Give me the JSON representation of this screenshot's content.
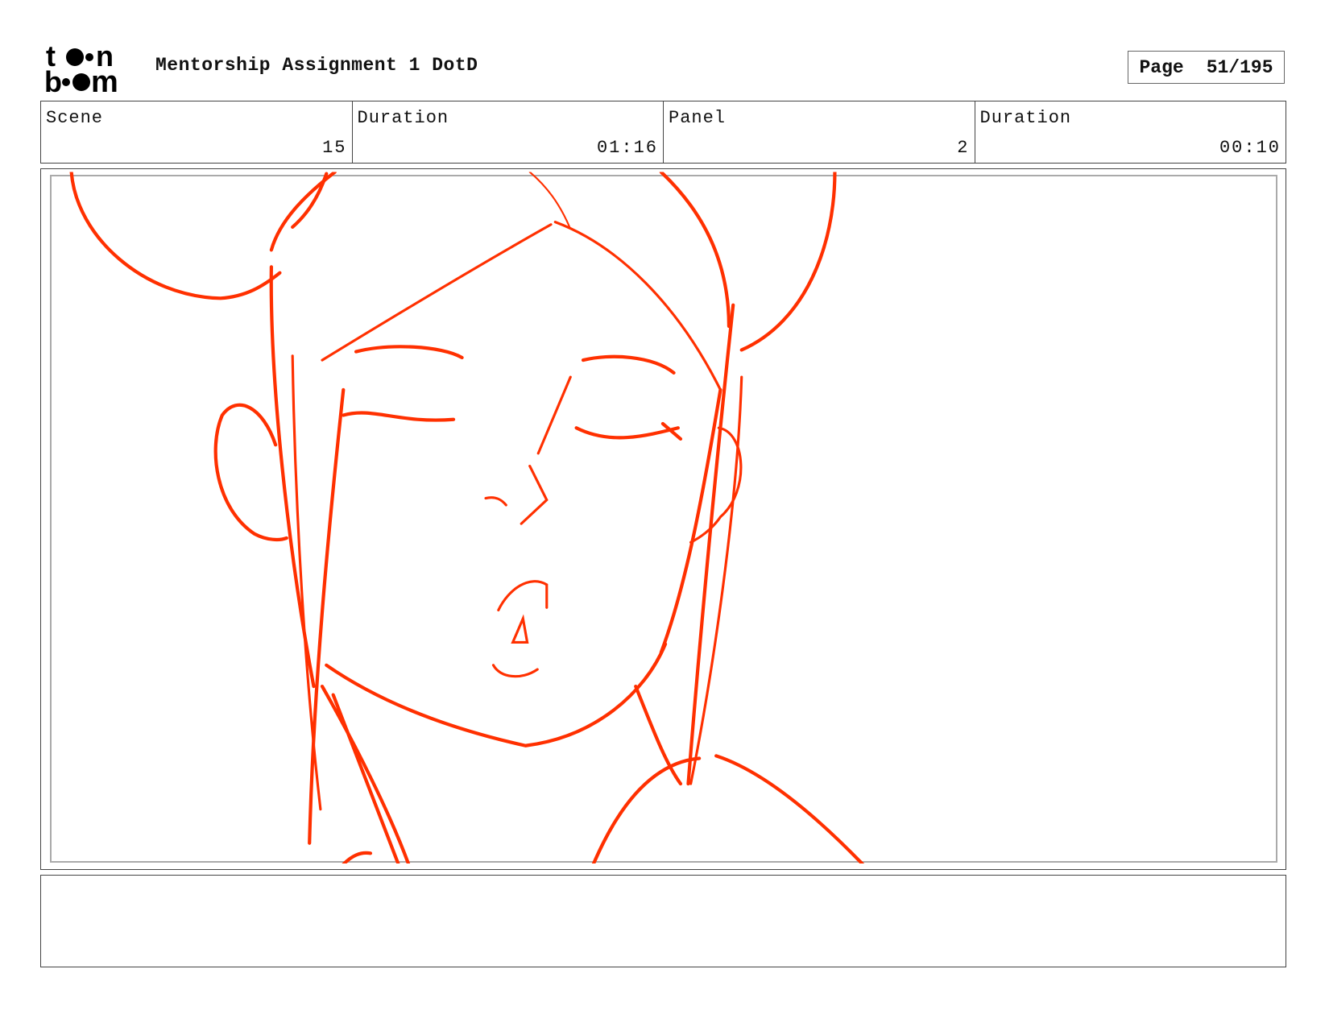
{
  "logo": {
    "text": "toon boom"
  },
  "header": {
    "title": "Mentorship Assignment 1 DotD",
    "page_label": "Page",
    "page_value": "51/195"
  },
  "info": [
    {
      "label": "Scene",
      "value": "15"
    },
    {
      "label": "Duration",
      "value": "01:16"
    },
    {
      "label": "Panel",
      "value": "2"
    },
    {
      "label": "Duration",
      "value": "00:10"
    }
  ],
  "caption": {
    "text": ""
  },
  "colors": {
    "sketch": "#ff3000",
    "frame": "#444444",
    "safe_frame": "#aaaaaa"
  }
}
